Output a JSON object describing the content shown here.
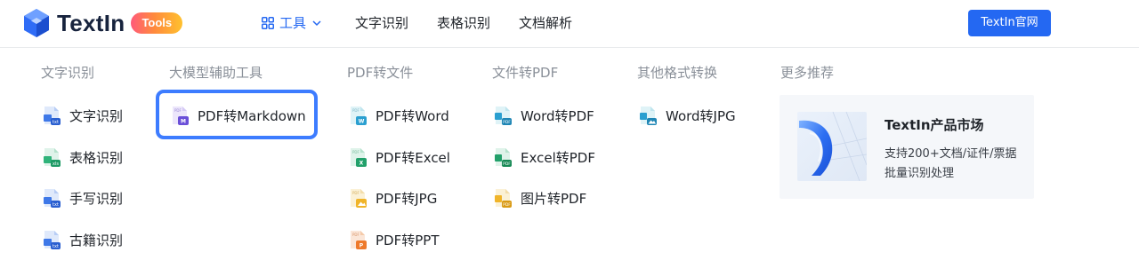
{
  "header": {
    "logo_text": "TextIn",
    "logo_badge": "Tools",
    "nav": {
      "tools": "工具",
      "ocr": "文字识别",
      "table": "表格识别",
      "doc_parse": "文档解析"
    },
    "cta_label": "TextIn官网"
  },
  "menu": {
    "col1": {
      "title": "文字识别",
      "items": [
        "文字识别",
        "表格识别",
        "手写识别",
        "古籍识别"
      ]
    },
    "col2": {
      "title": "大模型辅助工具",
      "items": [
        "PDF转Markdown"
      ]
    },
    "col3": {
      "title": "PDF转文件",
      "items": [
        "PDF转Word",
        "PDF转Excel",
        "PDF转JPG",
        "PDF转PPT"
      ]
    },
    "col4": {
      "title": "文件转PDF",
      "items": [
        "Word转PDF",
        "Excel转PDF",
        "图片转PDF"
      ]
    },
    "col5": {
      "title": "其他格式转换",
      "items": [
        "Word转JPG"
      ]
    },
    "col6": {
      "title": "更多推荐",
      "promo_title": "TextIn产品市场",
      "promo_desc": "支持200+文档/证件/票据批量识别处理"
    }
  },
  "colors": {
    "accent": "#2468f2",
    "highlight_border": "#3d7cff",
    "muted_text": "#8a9099"
  },
  "icons": {
    "ocr": "txt-file-icon",
    "table": "xls-file-icon",
    "markdown": "markdown-file-icon",
    "word": "word-file-icon",
    "excel": "excel-file-icon",
    "image": "image-file-icon",
    "ppt": "ppt-file-icon",
    "pdf": "pdf-file-icon"
  }
}
